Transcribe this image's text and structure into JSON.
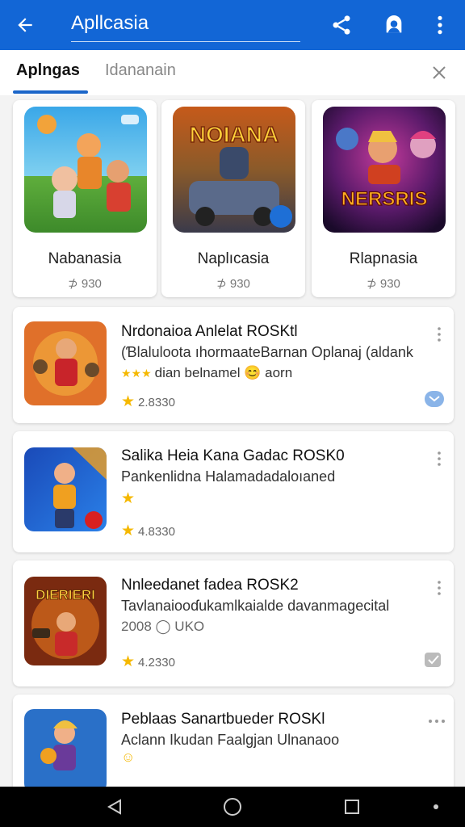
{
  "appbar": {
    "title": "Apllcasia",
    "color": "#1266d6",
    "back_icon": "back-arrow-icon",
    "actions": [
      "share-icon",
      "account-icon",
      "more-vert-icon"
    ]
  },
  "tabs": {
    "active_label": "Aplngas",
    "inactive_label": "Idananain",
    "accent": "#1b66c9"
  },
  "featured": [
    {
      "name": "Nabanasia",
      "meta": "⊅ 930"
    },
    {
      "name": "Naplıcasia",
      "meta": "⊅ 930",
      "thumb_text": "NOIANA"
    },
    {
      "name": "Rlapnasia",
      "meta": "⊅ 930",
      "thumb_text": "NERSRIS"
    }
  ],
  "list": [
    {
      "title": "Nrdonaioa Anlelat ROSKtl",
      "subtitle": "(Ɓlaluloota ıhormaateBarnan Oplanaj (aldank",
      "line3": "dian belnamel  😊 aorn",
      "rating": "2.8330"
    },
    {
      "title": "Salika Heia Kana Gadac ROSK0",
      "subtitle": "Pankenlidna Halamadadaloıaned",
      "line3": "",
      "rating": "4.8330"
    },
    {
      "title": "Nnleedanet fadea ROSK2",
      "subtitle": "Tavlanaiooɗukamlkaialde davanmagecital",
      "line3": "2008                    ◯ UKO",
      "rating": "4.2330",
      "thumb_text": "DIERIERI"
    },
    {
      "title": "Peblaas Sanartbueder ROSKl",
      "subtitle": "Aclann Ikudan Faalgjan Ulnanaoo",
      "line3": "",
      "rating": ""
    }
  ],
  "navbar": [
    "nav-back-icon",
    "nav-home-icon",
    "nav-recents-icon"
  ]
}
